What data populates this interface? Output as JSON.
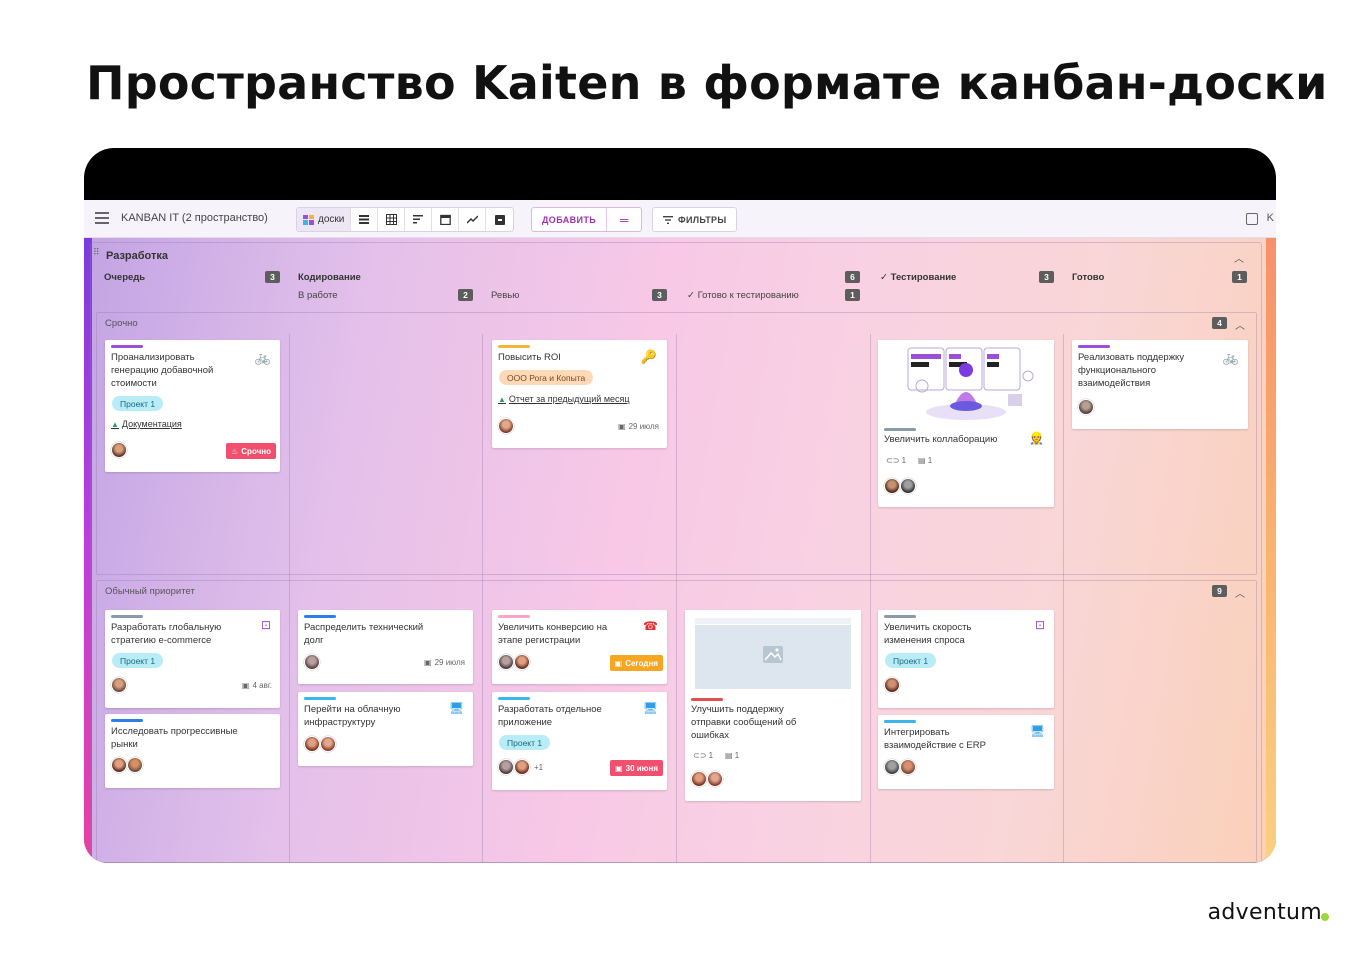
{
  "slide": {
    "title": "Пространство Kaiten в формате канбан-доски"
  },
  "topbar": {
    "space_title": "KANBAN IT (2 пространство)",
    "boards_label": "доски",
    "add_label": "ДОБАВИТЬ",
    "filters_label": "ФИЛЬТРЫ",
    "edge_letter": "K"
  },
  "board": {
    "group_title": "Разработка",
    "columns": {
      "queue": {
        "title": "Очередь",
        "count": "3"
      },
      "coding": {
        "title": "Кодирование",
        "count": "6"
      },
      "in_work": {
        "title": "В работе",
        "count": "2"
      },
      "review": {
        "title": "Ревью",
        "count": "3"
      },
      "ready_test": {
        "title": "Готово к тестированию",
        "count": "1"
      },
      "testing": {
        "title": "Тестирование",
        "count": "3"
      },
      "done": {
        "title": "Готово",
        "count": "1"
      }
    },
    "lanes": {
      "urgent": {
        "title": "Срочно",
        "count": "4"
      },
      "normal": {
        "title": "Обычный приоритет",
        "count": "9"
      }
    }
  },
  "cards": {
    "c1": {
      "title": "Проанализировать\nгенерацию добавочной\nстоимости",
      "tag": "Проект 1",
      "link": "Документация",
      "badge": "Срочно"
    },
    "c2": {
      "title": "Повысить ROI",
      "tag": "ООО Рога и Копыта",
      "link": "Отчет за предыдущий месяц",
      "date": "29 июля"
    },
    "c3": {
      "title": "Увеличить коллаборацию",
      "comments": "1",
      "attachments": "1"
    },
    "c4": {
      "title": "Реализовать поддержку\nфункционального\nвзаимодействия"
    },
    "c5": {
      "title": "Разработать глобальную\nстратегию e-commerce",
      "tag": "Проект 1",
      "date": "4 авг."
    },
    "c6": {
      "title": "Исследовать прогрессивные\nрынки"
    },
    "c7": {
      "title": "Распределить технический\nдолг",
      "date": "29 июля"
    },
    "c8": {
      "title": "Перейти на облачную\nинфраструктуру"
    },
    "c9": {
      "title": "Увеличить конверсию на\nэтапе регистрации",
      "badge": "Сегодня"
    },
    "c10": {
      "title": "Разработать отдельное\nприложение",
      "tag": "Проект 1",
      "plus": "+1",
      "badge": "30 июня"
    },
    "c11": {
      "title": "Улучшить поддержку\nотправки сообщений об\nошибках",
      "comments": "1",
      "attachments": "1"
    },
    "c12": {
      "title": "Увеличить скорость\nизменения спроса",
      "tag": "Проект 1"
    },
    "c13": {
      "title": "Интегрировать\nвзаимодействие с ERP"
    }
  },
  "brand": {
    "logo": "adventum"
  },
  "colors": {
    "purple": "#9b4fd6",
    "orange": "#f3b43a",
    "cyan": "#3ab6e8",
    "blue": "#2f7ee6",
    "red": "#e05050",
    "gray": "#8a9aa6",
    "urgent_badge": "#f0506e",
    "today_badge": "#f5a623"
  }
}
